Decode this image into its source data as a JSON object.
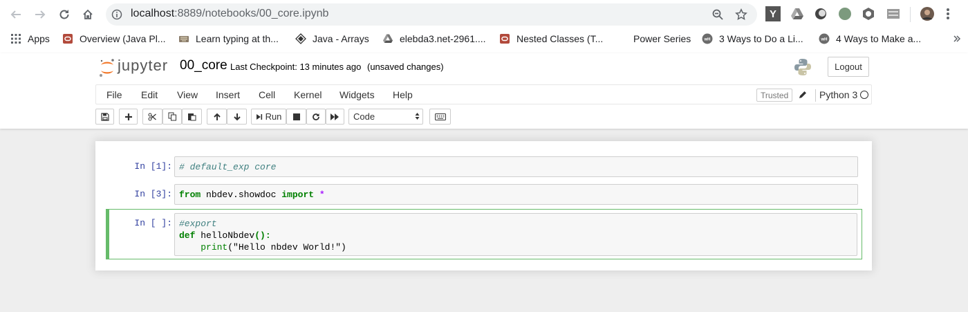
{
  "browser": {
    "url_host": "localhost",
    "url_rest": ":8889/notebooks/00_core.ipynb",
    "apps_label": "Apps",
    "bookmarks": [
      {
        "label": "Overview (Java Pl...",
        "icon": "oracle-icon"
      },
      {
        "label": "Learn typing at th...",
        "icon": "keyboard-icon"
      },
      {
        "label": "Java - Arrays",
        "icon": "diamond-icon"
      },
      {
        "label": "elebda3.net-2961....",
        "icon": "drive-icon"
      },
      {
        "label": "Nested Classes (T...",
        "icon": "oracle-icon"
      },
      {
        "label": "Power Series",
        "icon": "blank"
      },
      {
        "label": "3 Ways to Do a Li...",
        "icon": "wikihow-icon"
      },
      {
        "label": "4 Ways to Make a...",
        "icon": "wikihow-icon"
      }
    ]
  },
  "jupyter": {
    "logo_text": "jupyter",
    "notebook_name": "00_core",
    "checkpoint": "Last Checkpoint: 13 minutes ago",
    "autosave": "(unsaved changes)",
    "logout_label": "Logout",
    "menu": [
      "File",
      "Edit",
      "View",
      "Insert",
      "Cell",
      "Kernel",
      "Widgets",
      "Help"
    ],
    "trusted_label": "Trusted",
    "kernel_name": "Python 3",
    "toolbar": {
      "run_label": "Run",
      "cell_type": "Code"
    }
  },
  "cells": [
    {
      "prompt": "In [1]:",
      "lines": [
        [
          {
            "t": "# default_exp core",
            "c": "comment"
          }
        ]
      ]
    },
    {
      "prompt": "In [3]:",
      "lines": [
        [
          {
            "t": "from",
            "c": "keyword"
          },
          {
            "t": " nbdev.showdoc ",
            "c": ""
          },
          {
            "t": "import",
            "c": "keyword"
          },
          {
            "t": " ",
            "c": ""
          },
          {
            "t": "*",
            "c": "op"
          }
        ]
      ]
    },
    {
      "prompt": "In [ ]:",
      "lines": [
        [
          {
            "t": "#export",
            "c": "comment"
          }
        ],
        [
          {
            "t": "def",
            "c": "keyword"
          },
          {
            "t": " helloNbdev",
            "c": ""
          },
          {
            "t": "():",
            "c": "keyword"
          }
        ],
        [
          {
            "t": "    ",
            "c": ""
          },
          {
            "t": "print",
            "c": "builtin"
          },
          {
            "t": "(\"Hello nbdev World!\")",
            "c": ""
          }
        ]
      ]
    }
  ]
}
